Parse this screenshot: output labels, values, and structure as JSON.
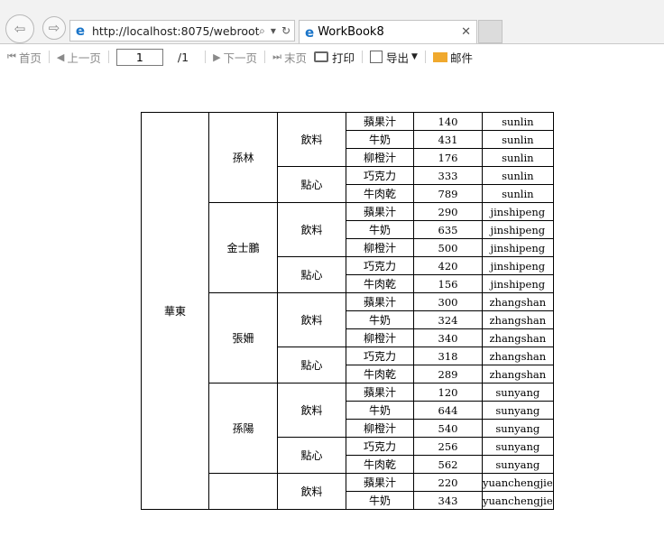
{
  "browser": {
    "url": "http://localhost:8075/webroot",
    "tab_title": "WorkBook8",
    "back_glyph": "⇦",
    "fwd_glyph": "⇨",
    "ie_glyph": "e",
    "search_glyph": "⌕",
    "dropdown_glyph": "▾",
    "refresh_glyph": "↻",
    "close_glyph": "✕"
  },
  "toolbar": {
    "first_label": "首页",
    "prev_label": "上一页",
    "page_value": "1",
    "page_total": "/1",
    "next_label": "下一页",
    "last_label": "末页",
    "print_label": "打印",
    "export_label": "导出",
    "mail_label": "邮件"
  },
  "report": {
    "region": "華東",
    "salespeople": [
      {
        "name": "孫林",
        "categories": [
          {
            "name": "飲料",
            "items": [
              [
                "蘋果汁",
                "140",
                "sunlin"
              ],
              [
                "牛奶",
                "431",
                "sunlin"
              ],
              [
                "柳橙汁",
                "176",
                "sunlin"
              ]
            ]
          },
          {
            "name": "點心",
            "items": [
              [
                "巧克力",
                "333",
                "sunlin"
              ],
              [
                "牛肉乾",
                "789",
                "sunlin"
              ]
            ]
          }
        ]
      },
      {
        "name": "金士鵬",
        "categories": [
          {
            "name": "飲料",
            "items": [
              [
                "蘋果汁",
                "290",
                "jinshipeng"
              ],
              [
                "牛奶",
                "635",
                "jinshipeng"
              ],
              [
                "柳橙汁",
                "500",
                "jinshipeng"
              ]
            ]
          },
          {
            "name": "點心",
            "items": [
              [
                "巧克力",
                "420",
                "jinshipeng"
              ],
              [
                "牛肉乾",
                "156",
                "jinshipeng"
              ]
            ]
          }
        ]
      },
      {
        "name": "張姍",
        "categories": [
          {
            "name": "飲料",
            "items": [
              [
                "蘋果汁",
                "300",
                "zhangshan"
              ],
              [
                "牛奶",
                "324",
                "zhangshan"
              ],
              [
                "柳橙汁",
                "340",
                "zhangshan"
              ]
            ]
          },
          {
            "name": "點心",
            "items": [
              [
                "巧克力",
                "318",
                "zhangshan"
              ],
              [
                "牛肉乾",
                "289",
                "zhangshan"
              ]
            ]
          }
        ]
      },
      {
        "name": "孫陽",
        "categories": [
          {
            "name": "飲料",
            "items": [
              [
                "蘋果汁",
                "120",
                "sunyang"
              ],
              [
                "牛奶",
                "644",
                "sunyang"
              ],
              [
                "柳橙汁",
                "540",
                "sunyang"
              ]
            ]
          },
          {
            "name": "點心",
            "items": [
              [
                "巧克力",
                "256",
                "sunyang"
              ],
              [
                "牛肉乾",
                "562",
                "sunyang"
              ]
            ]
          }
        ]
      },
      {
        "name": "",
        "categories": [
          {
            "name": "飲料",
            "items": [
              [
                "蘋果汁",
                "220",
                "yuanchengjie"
              ],
              [
                "牛奶",
                "343",
                "yuanchengjie"
              ]
            ]
          }
        ]
      }
    ]
  }
}
